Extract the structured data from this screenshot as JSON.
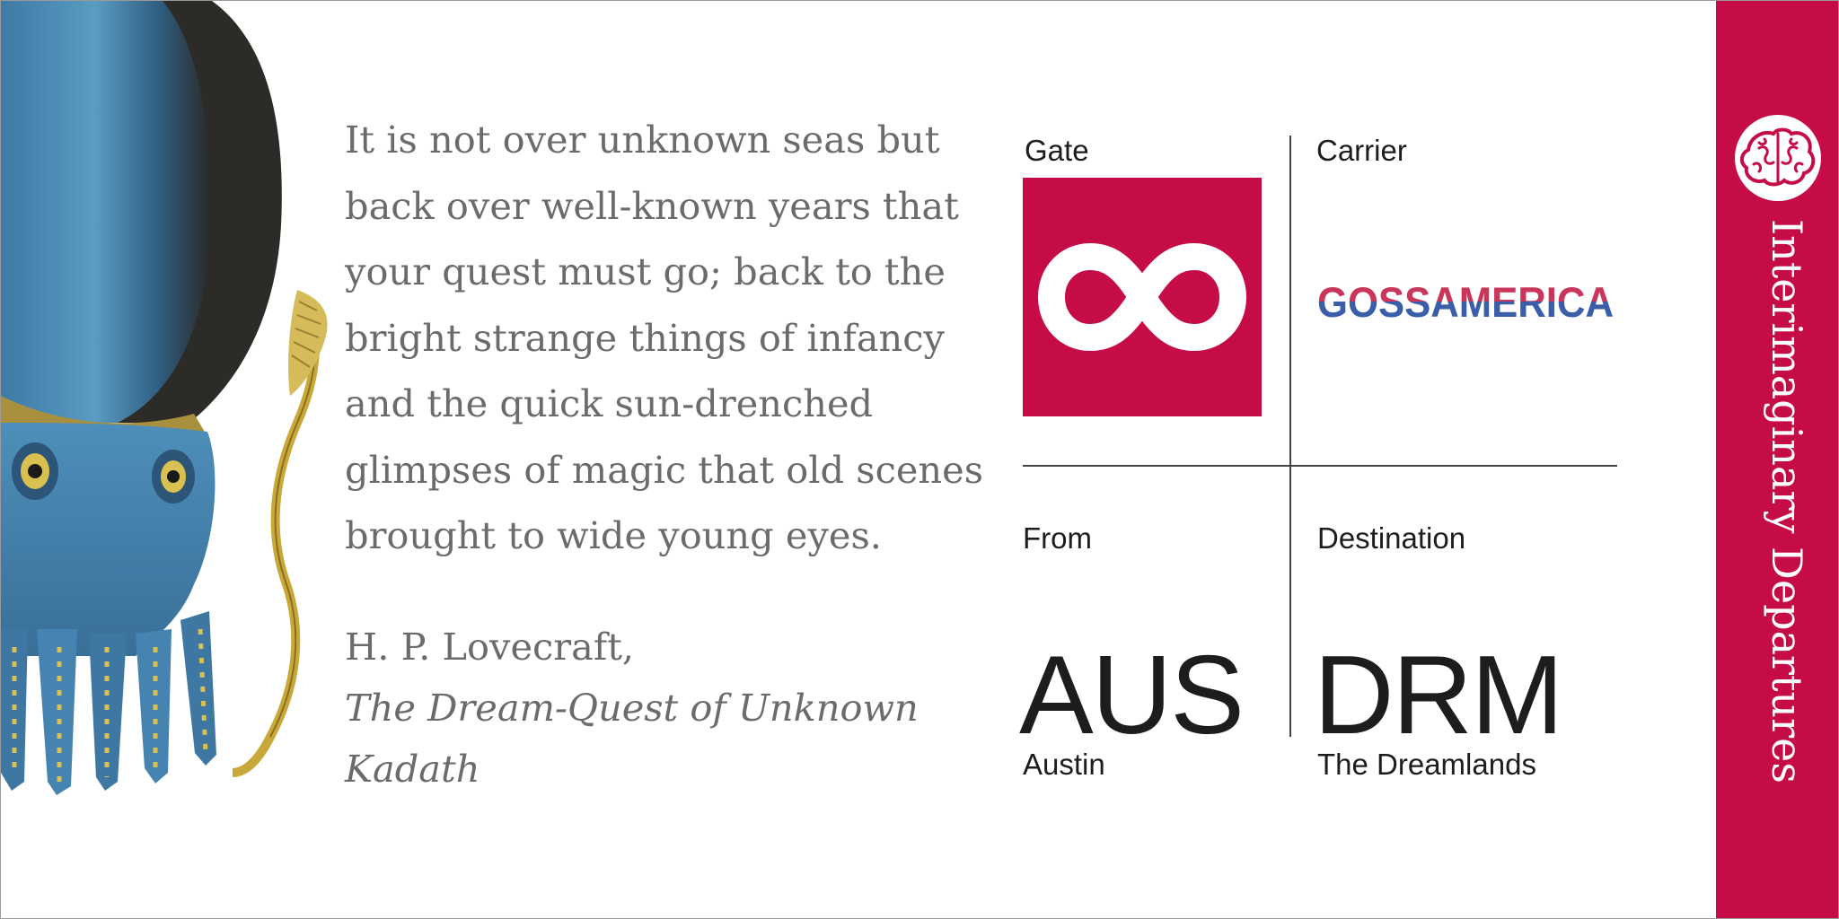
{
  "quote": {
    "text": "It is not over unknown seas but back over well-known years that your quest must go; back to the bright strange things of infancy and the quick sun-drenched glimpses of magic that old scenes brought to wide young eyes.",
    "author": "H. P. Lovecraft,",
    "work": "The Dream-Quest of Unknown Kadath"
  },
  "gate": {
    "label": "Gate",
    "icon": "infinity-icon"
  },
  "carrier": {
    "label": "Carrier",
    "name": "GOSSAMERICA"
  },
  "from": {
    "label": "From",
    "code": "AUS",
    "city": "Austin"
  },
  "destination": {
    "label": "Destination",
    "code": "DRM",
    "city": "The Dreamlands"
  },
  "side": {
    "title": "Interimaginary Departures",
    "emblem": "brain-icon"
  },
  "colors": {
    "accent": "#c60c46",
    "text_dark": "#1d1d1d",
    "text_quote": "#6b6b6b",
    "carrier_red": "#c9365a",
    "carrier_blue": "#3a5ea8"
  }
}
